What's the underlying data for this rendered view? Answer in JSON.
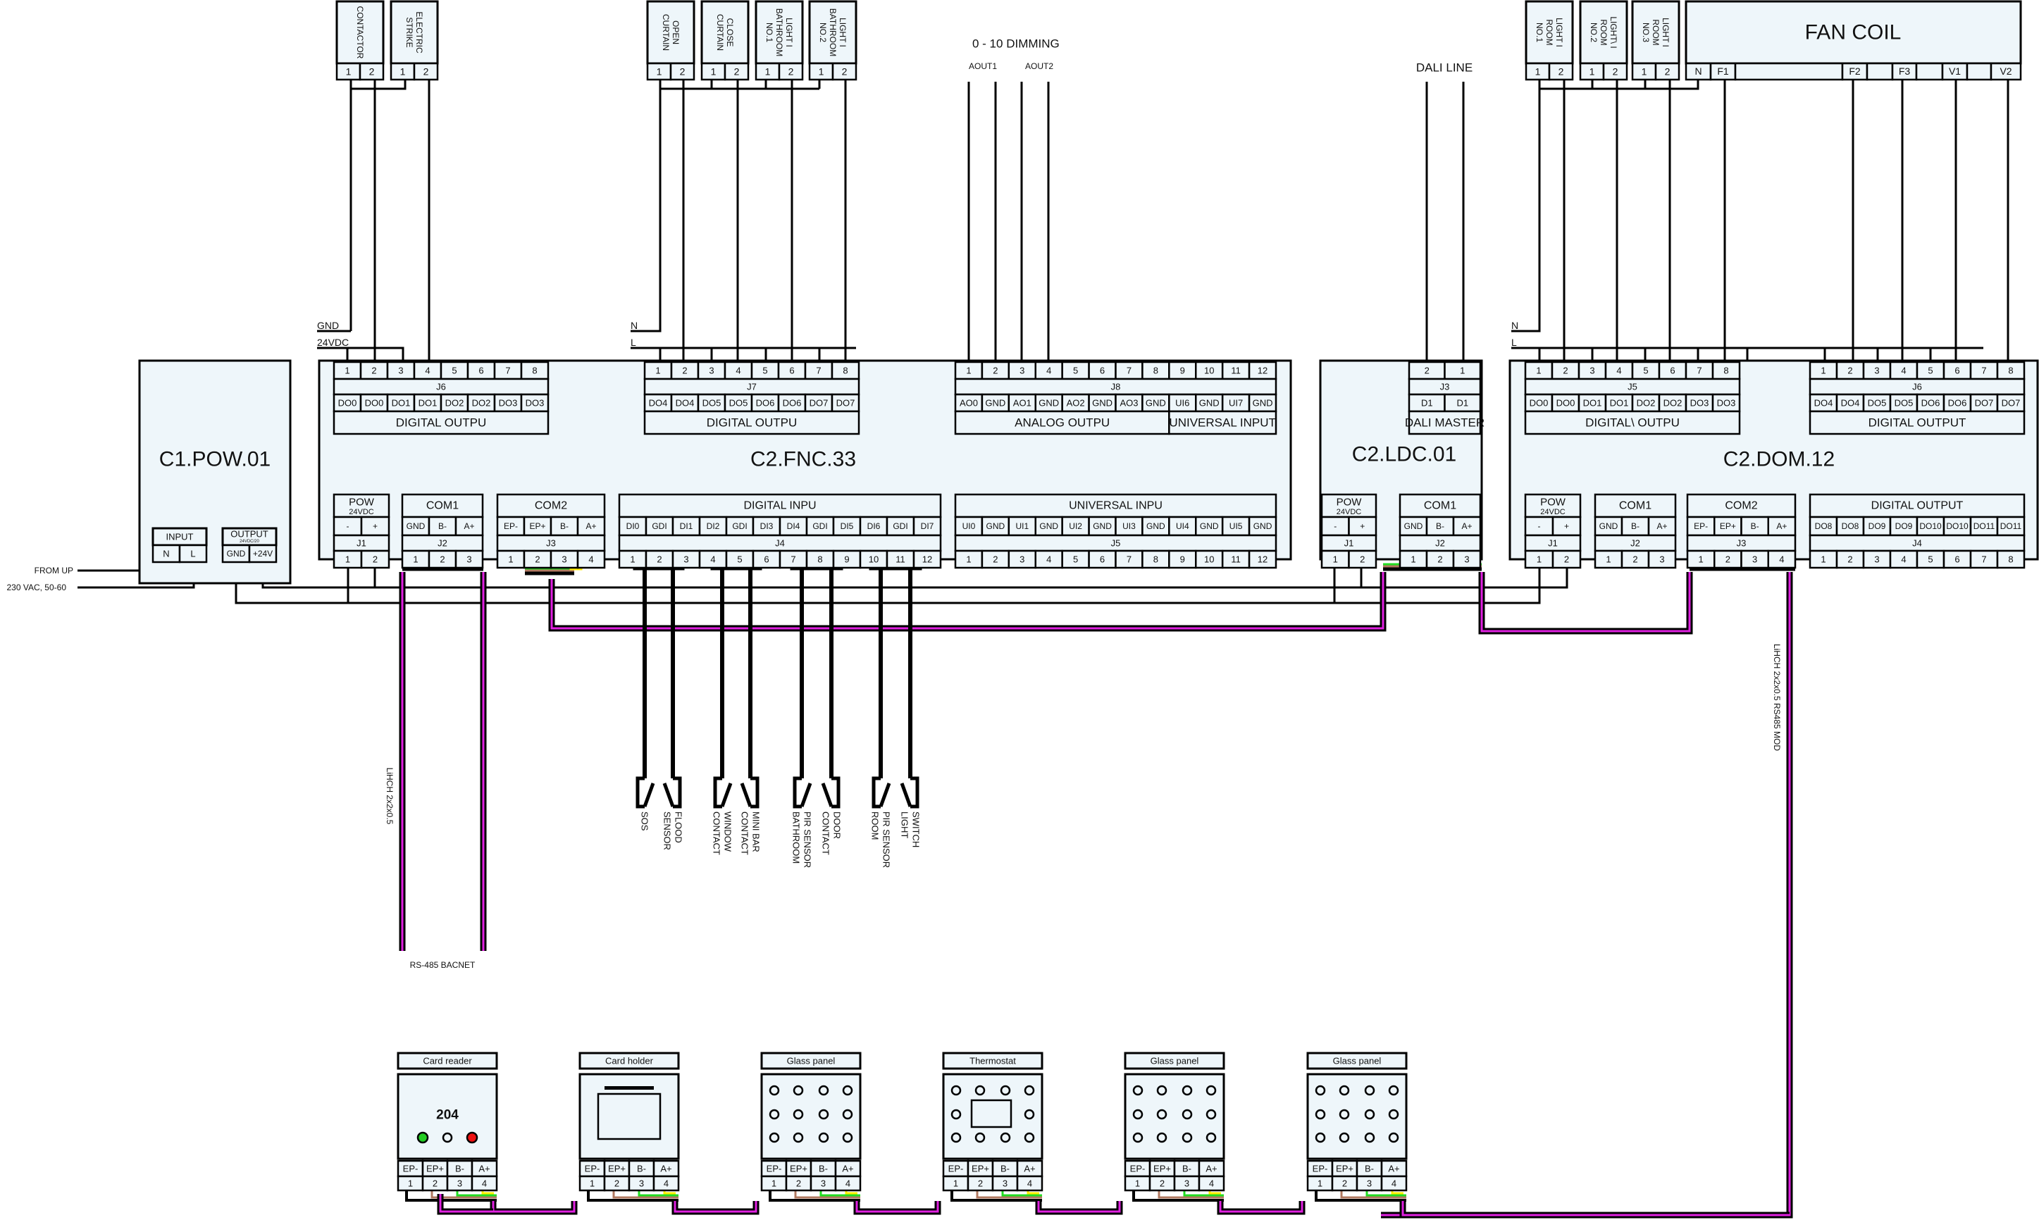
{
  "colors": {
    "box_fill": "#eef6fa",
    "stroke": "#000000",
    "bus_magenta": "#e020e0",
    "wire_brown": "#b07860",
    "wire_green": "#22dd22",
    "wire_yellow": "#ffee00",
    "led_green": "#22cc22",
    "led_red": "#ee1111"
  },
  "labels": {
    "dimming": "0 - 10 DIMMING",
    "aout1": "AOUT1",
    "aout2": "AOUT2",
    "dali_line": "DALI  LINE",
    "gnd_left": "GND",
    "vdc_left": "24VDC",
    "n_mid": "N",
    "l_mid": "L",
    "n_right": "N",
    "l_right": "L",
    "from_up": "FROM  UP",
    "mains": "230  VAC,  50-60",
    "cable_bacnet": "LiHCH  2x2x0.5",
    "rs485_bacnet": "RS-485 BACNET",
    "cable_mod": "LiHCH  2x2x0.5  RS485  MOD"
  },
  "field_devices_top": [
    {
      "label": "CONTACTOR",
      "pins": [
        "1",
        "2"
      ]
    },
    {
      "label": "ELECTRIC STRIKE",
      "pins": [
        "1",
        "2"
      ]
    },
    {
      "label": "OPEN CURTAIN",
      "pins": [
        "1",
        "2"
      ]
    },
    {
      "label": "CLOSE CURTAIN",
      "pins": [
        "1",
        "2"
      ]
    },
    {
      "label": "LIGHT I BATHROOM NO.1",
      "pins": [
        "1",
        "2"
      ]
    },
    {
      "label": "LIGHT I BATHROOM NO.2",
      "pins": [
        "1",
        "2"
      ]
    },
    {
      "label": "LIGHT I ROOM NO.1",
      "pins": [
        "1",
        "2"
      ]
    },
    {
      "label": "LIGHT\\ I ROOM NO.2",
      "pins": [
        "1",
        "2"
      ]
    },
    {
      "label": "LIGHT I ROOM NO.3",
      "pins": [
        "1",
        "2"
      ]
    }
  ],
  "fan_coil": {
    "title": "FAN  COIL",
    "terminals": [
      "N",
      "F1",
      "",
      "F2",
      "",
      "F3",
      "",
      "V1",
      "",
      "V2"
    ]
  },
  "pow": {
    "title": "C1.POW.01",
    "input": {
      "label": "INPUT",
      "pins": [
        "N",
        "L"
      ]
    },
    "output": {
      "label": "OUTPUT",
      "sub": "24VDC/20",
      "pins": [
        "GND",
        "+24V"
      ]
    }
  },
  "fnc": {
    "title": "C2.FNC.33",
    "j6": {
      "name": "J6",
      "nums": [
        "1",
        "2",
        "3",
        "4",
        "5",
        "6",
        "7",
        "8"
      ],
      "sig": [
        "DO0",
        "DO0",
        "DO1",
        "DO1",
        "DO2",
        "DO2",
        "DO3",
        "DO3"
      ],
      "group": "DIGITAL  OUTPU"
    },
    "j7": {
      "name": "J7",
      "nums": [
        "1",
        "2",
        "3",
        "4",
        "5",
        "6",
        "7",
        "8"
      ],
      "sig": [
        "DO4",
        "DO4",
        "DO5",
        "DO5",
        "DO6",
        "DO6",
        "DO7",
        "DO7"
      ],
      "group": "DIGITAL  OUTPU"
    },
    "j8": {
      "name": "J8",
      "nums": [
        "1",
        "2",
        "3",
        "4",
        "5",
        "6",
        "7",
        "8",
        "9",
        "10",
        "11",
        "12"
      ],
      "sig": [
        "AO0",
        "GND",
        "AO1",
        "GND",
        "AO2",
        "GND",
        "AO3",
        "GND",
        "UI6",
        "GND",
        "UI7",
        "GND"
      ],
      "group_a": "ANALOG  OUTPU",
      "group_b": "UNIVERSAL  INPUT"
    },
    "j1": {
      "name": "J1",
      "title": "POW",
      "sub": "24VDC",
      "sig": [
        "-",
        "+"
      ],
      "nums": [
        "1",
        "2"
      ]
    },
    "j2": {
      "name": "J2",
      "title": "COM1",
      "sig": [
        "GND",
        "B-",
        "A+"
      ],
      "nums": [
        "1",
        "2",
        "3"
      ]
    },
    "j3": {
      "name": "J3",
      "title": "COM2",
      "sig": [
        "EP-",
        "EP+",
        "B-",
        "A+"
      ],
      "nums": [
        "1",
        "2",
        "3",
        "4"
      ]
    },
    "j4": {
      "name": "J4",
      "title": "DIGITAL  INPU",
      "sig": [
        "DI0",
        "GDI",
        "DI1",
        "DI2",
        "GDI",
        "DI3",
        "DI4",
        "GDI",
        "DI5",
        "DI6",
        "GDI",
        "DI7"
      ],
      "nums": [
        "1",
        "2",
        "3",
        "4",
        "5",
        "6",
        "7",
        "8",
        "9",
        "10",
        "11",
        "12"
      ]
    },
    "j5": {
      "name": "J5",
      "title": "UNIVERSAL  INPU",
      "sig": [
        "UI0",
        "GND",
        "UI1",
        "GND",
        "UI2",
        "GND",
        "UI3",
        "GND",
        "UI4",
        "GND",
        "UI5",
        "GND"
      ],
      "nums": [
        "1",
        "2",
        "3",
        "4",
        "5",
        "6",
        "7",
        "8",
        "9",
        "10",
        "11",
        "12"
      ]
    }
  },
  "ldc": {
    "title": "C2.LDC.01",
    "j3": {
      "name": "J3",
      "nums": [
        "2",
        "1"
      ],
      "sig": [
        "D1",
        "D1"
      ],
      "group": "DALI MASTER"
    },
    "j1": {
      "name": "J1",
      "title": "POW",
      "sub": "24VDC",
      "sig": [
        "-",
        "+"
      ],
      "nums": [
        "1",
        "2"
      ]
    },
    "j2": {
      "name": "J2",
      "title": "COM1",
      "sig": [
        "GND",
        "B-",
        "A+"
      ],
      "nums": [
        "1",
        "2",
        "3"
      ]
    }
  },
  "dom": {
    "title": "C2.DOM.12",
    "j5": {
      "name": "J5",
      "nums": [
        "1",
        "2",
        "3",
        "4",
        "5",
        "6",
        "7",
        "8"
      ],
      "sig": [
        "DO0",
        "DO0",
        "DO1",
        "DO1",
        "DO2",
        "DO2",
        "DO3",
        "DO3"
      ],
      "group": "DIGITAL\\ OUTPU"
    },
    "j6": {
      "name": "J6",
      "nums": [
        "1",
        "2",
        "3",
        "4",
        "5",
        "6",
        "7",
        "8"
      ],
      "sig": [
        "DO4",
        "DO4",
        "DO5",
        "DO5",
        "DO6",
        "DO6",
        "DO7",
        "DO7"
      ],
      "group": "DIGITAL  OUTPUT"
    },
    "j1": {
      "name": "J1",
      "title": "POW",
      "sub": "24VDC",
      "sig": [
        "-",
        "+"
      ],
      "nums": [
        "1",
        "2"
      ]
    },
    "j2": {
      "name": "J2",
      "title": "COM1",
      "sig": [
        "GND",
        "B-",
        "A+"
      ],
      "nums": [
        "1",
        "2",
        "3"
      ]
    },
    "j3": {
      "name": "J3",
      "title": "COM2",
      "sig": [
        "EP-",
        "EP+",
        "B-",
        "A+"
      ],
      "nums": [
        "1",
        "2",
        "3",
        "4"
      ]
    },
    "j4": {
      "name": "J4",
      "title": "DIGITAL  OUTPUT",
      "sig": [
        "DO8",
        "DO8",
        "DO9",
        "DO9",
        "DO10",
        "DO10",
        "DO11",
        "DO11"
      ],
      "nums": [
        "1",
        "2",
        "3",
        "4",
        "5",
        "6",
        "7",
        "8"
      ]
    }
  },
  "sensors": [
    {
      "label": "SOS"
    },
    {
      "label": "FLOOD SENSOR"
    },
    {
      "label": "WINDOW CONTACT"
    },
    {
      "label": "MINI BAR CONTACT"
    },
    {
      "label": "PIR SENSOR BATHROOM"
    },
    {
      "label": "DOOR CONTACT"
    },
    {
      "label": "PIR SENSOR ROOM"
    },
    {
      "label": "SWITCH LIGHT"
    }
  ],
  "room_devices": [
    {
      "label": "Card  reader",
      "kind": "card-reader",
      "display": "204",
      "sig": [
        "EP-",
        "EP+",
        "B-",
        "A+"
      ],
      "nums": [
        "1",
        "2",
        "3",
        "4"
      ]
    },
    {
      "label": "Card  holder",
      "kind": "card-holder",
      "sig": [
        "EP-",
        "EP+",
        "B-",
        "A+"
      ],
      "nums": [
        "1",
        "2",
        "3",
        "4"
      ]
    },
    {
      "label": "Glass  panel",
      "kind": "glass-panel",
      "sig": [
        "EP-",
        "EP+",
        "B-",
        "A+"
      ],
      "nums": [
        "1",
        "2",
        "3",
        "4"
      ]
    },
    {
      "label": "Thermostat",
      "kind": "thermostat",
      "sig": [
        "EP-",
        "EP+",
        "B-",
        "A+"
      ],
      "nums": [
        "1",
        "2",
        "3",
        "4"
      ]
    },
    {
      "label": "Glass  panel",
      "kind": "glass-panel",
      "sig": [
        "EP-",
        "EP+",
        "B-",
        "A+"
      ],
      "nums": [
        "1",
        "2",
        "3",
        "4"
      ]
    },
    {
      "label": "Glass  panel",
      "kind": "glass-panel",
      "sig": [
        "EP-",
        "EP+",
        "B-",
        "A+"
      ],
      "nums": [
        "1",
        "2",
        "3",
        "4"
      ]
    }
  ]
}
